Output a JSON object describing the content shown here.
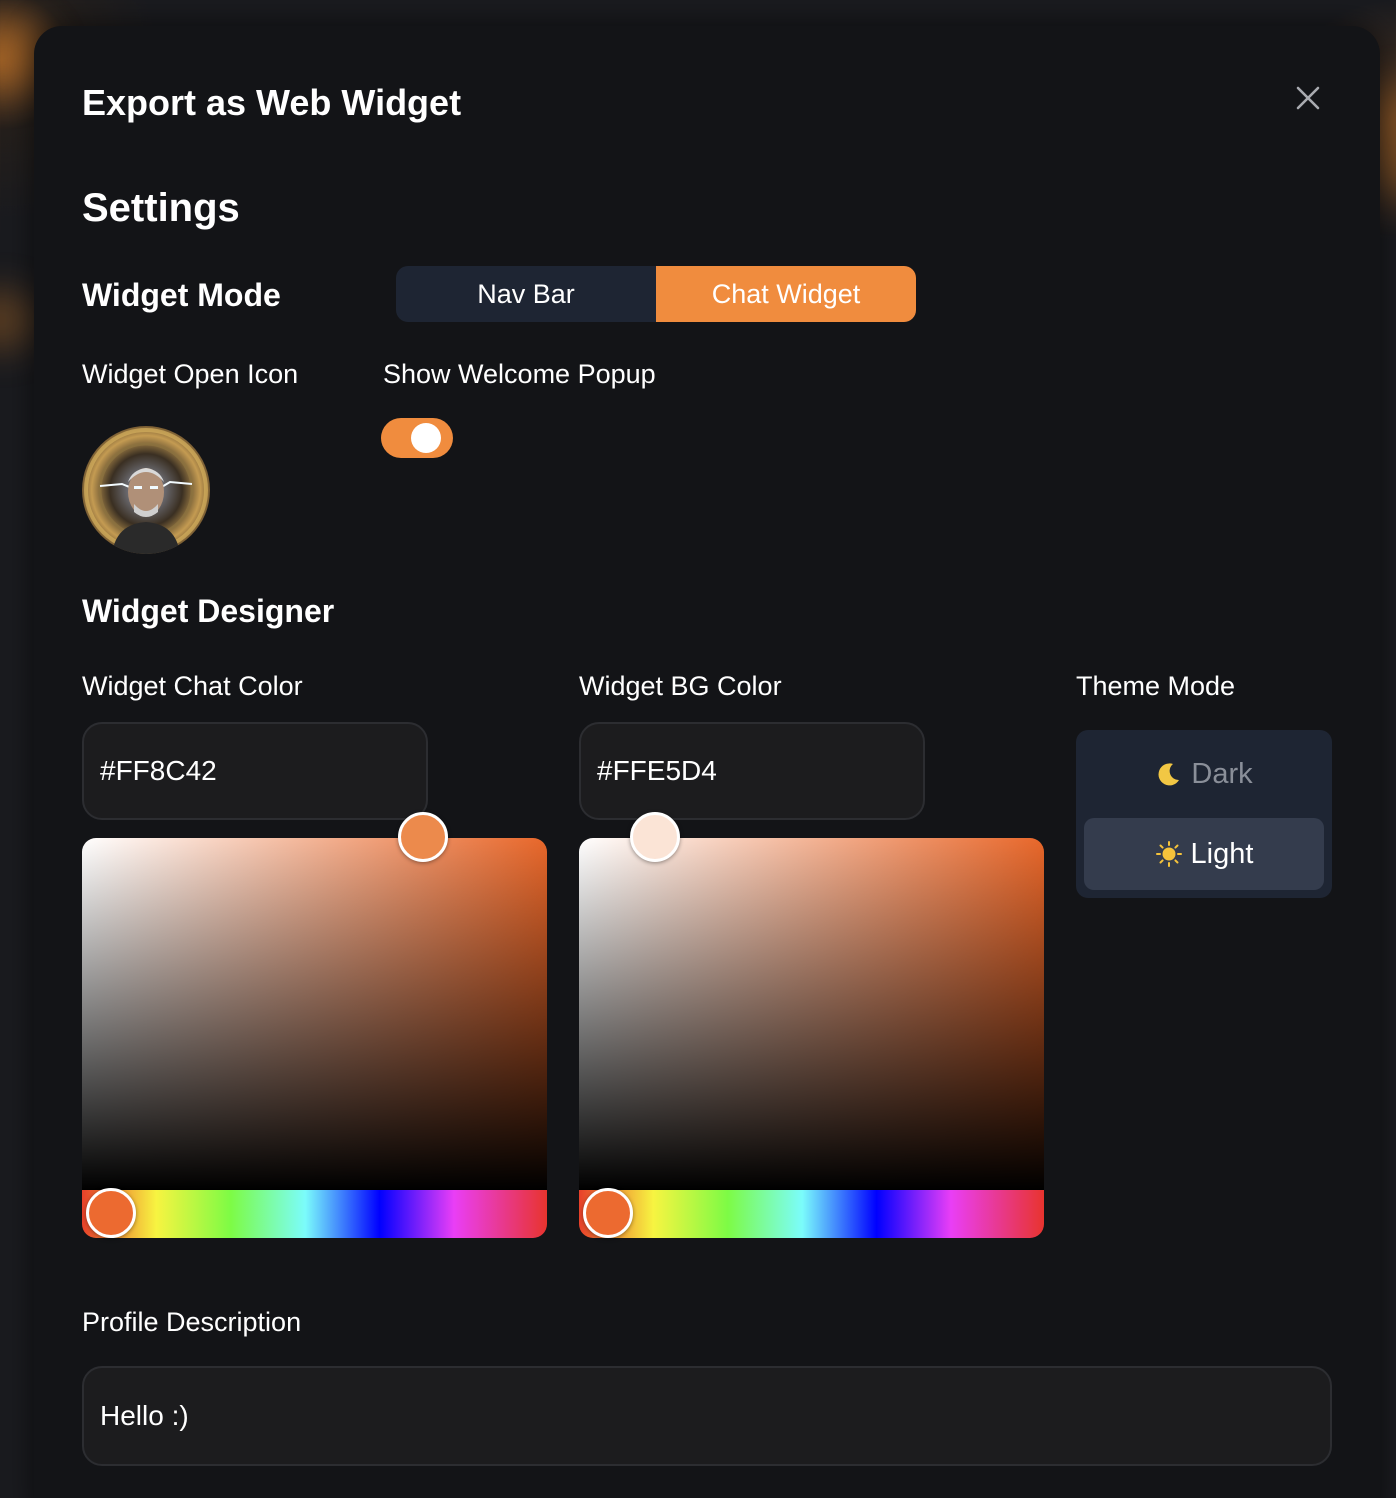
{
  "modal": {
    "title": "Export as Web Widget",
    "close_icon": "close-icon"
  },
  "settings": {
    "heading": "Settings",
    "widget_mode": {
      "label": "Widget Mode",
      "options": [
        "Nav Bar",
        "Chat Widget"
      ],
      "selected": "Chat Widget"
    },
    "open_icon_label": "Widget Open Icon",
    "welcome_popup": {
      "label": "Show Welcome Popup",
      "enabled": true
    }
  },
  "designer": {
    "heading": "Widget Designer",
    "chat_color": {
      "label": "Widget Chat Color",
      "value": "#FF8C42"
    },
    "bg_color": {
      "label": "Widget BG Color",
      "value": "#FFE5D4"
    },
    "theme": {
      "label": "Theme Mode",
      "dark_label": "Dark",
      "dark_icon": "moon-icon",
      "light_label": "Light",
      "light_icon": "sun-icon",
      "selected": "Light"
    }
  },
  "profile": {
    "label": "Profile Description",
    "value": "Hello :)"
  },
  "colors": {
    "accent": "#f08c3e",
    "panel_bg": "#131417",
    "segment_bg": "#1e2533",
    "selected_theme_bg": "#343c4d",
    "hue_handle": "#ec6a30"
  }
}
